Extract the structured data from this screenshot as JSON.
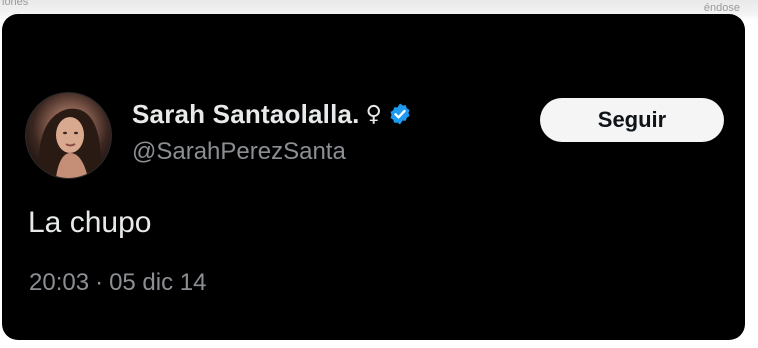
{
  "background": {
    "fragment_left": "iones",
    "fragment_right": "éndose"
  },
  "tweet": {
    "display_name": "Sarah Santaolalla.",
    "gender_symbol": "♀",
    "verified_icon": "verified-badge-icon",
    "handle": "@SarahPerezSanta",
    "follow_label": "Seguir",
    "text": "La chupo",
    "time": "20:03",
    "separator": "·",
    "date": "05 dic 14"
  },
  "colors": {
    "card_bg": "#000000",
    "primary_text": "#e7e9ea",
    "secondary_text": "#8b8f93",
    "verified_blue": "#1d9bf0",
    "button_bg": "#f5f5f5"
  }
}
